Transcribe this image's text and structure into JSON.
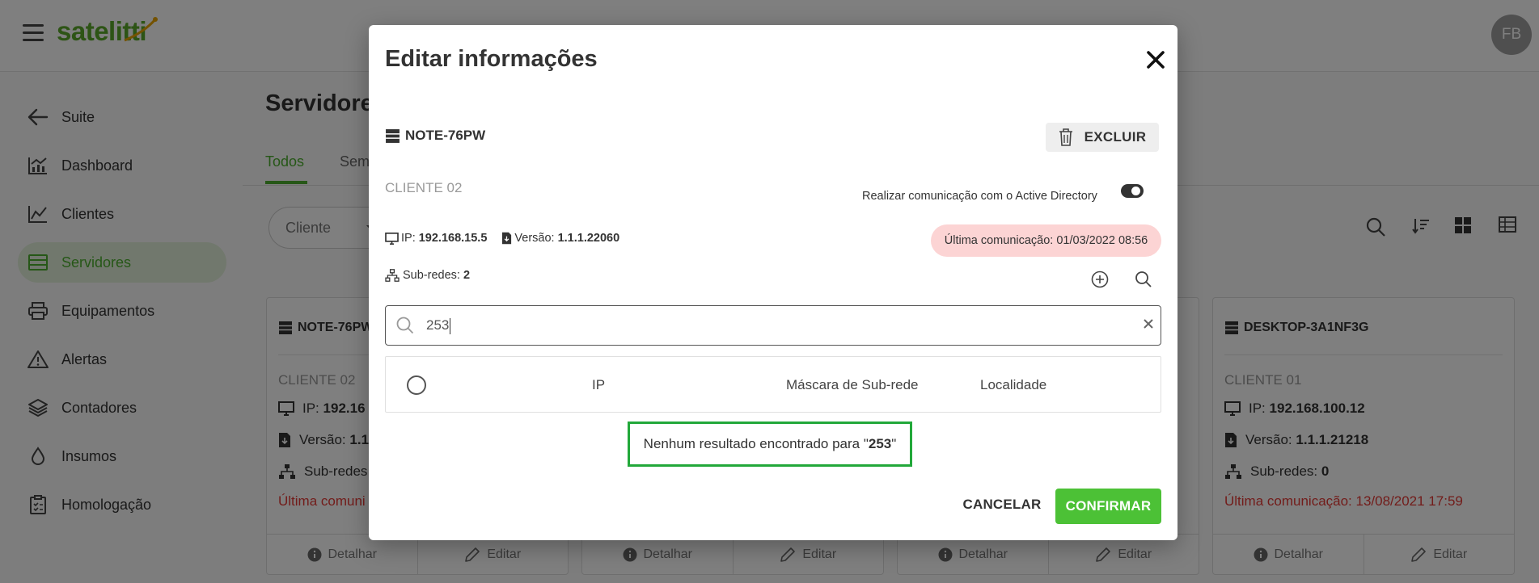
{
  "header": {
    "logo": "satelitti",
    "avatar_initials": "FB"
  },
  "sidebar": {
    "items": [
      {
        "label": "Suite",
        "icon": "arrow-left-icon"
      },
      {
        "label": "Dashboard",
        "icon": "dashboard-chart-icon"
      },
      {
        "label": "Clientes",
        "icon": "clients-chart-icon"
      },
      {
        "label": "Servidores",
        "icon": "server-icon",
        "active": true
      },
      {
        "label": "Equipamentos",
        "icon": "printer-icon"
      },
      {
        "label": "Alertas",
        "icon": "warning-icon"
      },
      {
        "label": "Contadores",
        "icon": "layers-icon"
      },
      {
        "label": "Insumos",
        "icon": "drop-icon"
      },
      {
        "label": "Homologação",
        "icon": "clipboard-icon"
      }
    ]
  },
  "page": {
    "title": "Servidores",
    "tabs": [
      {
        "label": "Todos"
      },
      {
        "label": "Sem"
      }
    ],
    "filter_label": "Cliente"
  },
  "cards": [
    {
      "name": "NOTE-76PW",
      "client": "CLIENTE 02",
      "ip_label": "IP:",
      "ip": "192.16",
      "version_label": "Versão:",
      "version": "1.1",
      "subnets_label": "Sub-redes",
      "subnets": "",
      "last": "Última comuni",
      "detail": "Detalhar",
      "edit": "Editar"
    },
    {
      "detail": "Detalhar",
      "edit": "Editar"
    },
    {
      "detail": "Detalhar",
      "edit": "Editar"
    },
    {
      "name": "DESKTOP-3A1NF3G",
      "client": "CLIENTE 01",
      "ip_label": "IP:",
      "ip": "192.168.100.12",
      "version_label": "Versão:",
      "version": "1.1.1.21218",
      "subnets_label": "Sub-redes:",
      "subnets": "0",
      "last": "Última comunicação: 13/08/2021 17:59",
      "detail": "Detalhar",
      "edit": "Editar"
    }
  ],
  "modal": {
    "title": "Editar informações",
    "server_name": "NOTE-76PW",
    "delete_label": "EXCLUIR",
    "client": "CLIENTE 02",
    "ad_label": "Realizar comunicação com o Active Directory",
    "ad_enabled": true,
    "ip_label": "IP:",
    "ip": "192.168.15.5",
    "version_label": "Versão:",
    "version": "1.1.1.22060",
    "last_comm": "Última comunicação: 01/03/2022 08:56",
    "subnets_label": "Sub-redes:",
    "subnets_count": "2",
    "search_value": "253",
    "table_headers": {
      "ip": "IP",
      "mask": "Máscara de Sub-rede",
      "location": "Localidade"
    },
    "no_result_prefix": "Nenhum resultado encontrado para \"",
    "no_result_term": "253",
    "no_result_suffix": "\"",
    "cancel_label": "CANCELAR",
    "confirm_label": "CONFIRMAR"
  },
  "colors": {
    "brand": "#5aa82a",
    "accent_green": "#4caf2f",
    "confirm": "#4cc136",
    "danger_text": "#e53935",
    "badge_pink": "#fcd4d4",
    "highlight_box": "#22a83a"
  }
}
